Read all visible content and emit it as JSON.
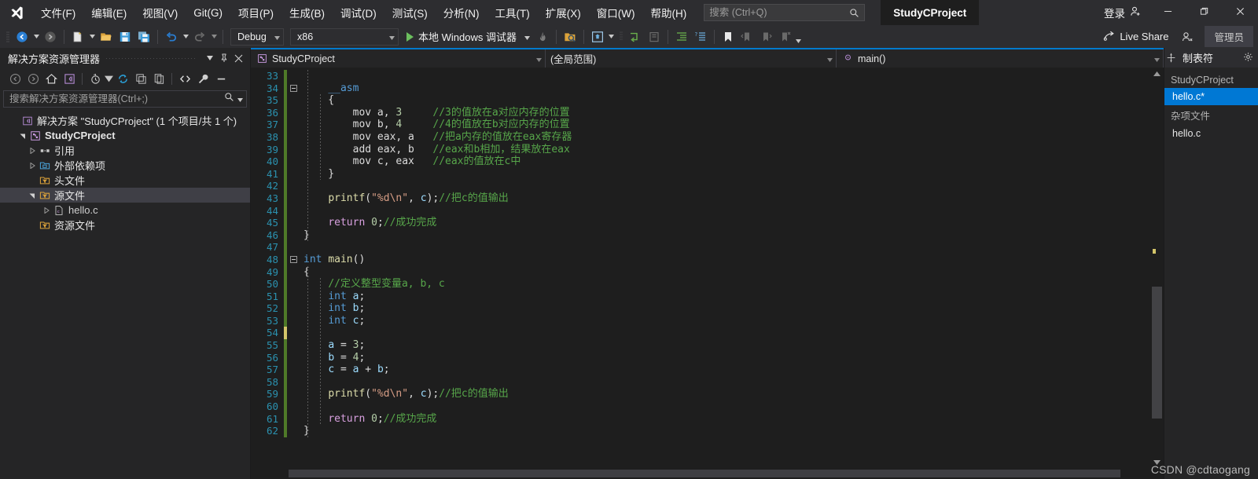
{
  "titlebar": {
    "logo_icon": "visual-studio-logo",
    "menu": [
      {
        "label": "文件(F)"
      },
      {
        "label": "编辑(E)"
      },
      {
        "label": "视图(V)"
      },
      {
        "label": "Git(G)"
      },
      {
        "label": "项目(P)"
      },
      {
        "label": "生成(B)"
      },
      {
        "label": "调试(D)"
      },
      {
        "label": "测试(S)"
      },
      {
        "label": "分析(N)"
      },
      {
        "label": "工具(T)"
      },
      {
        "label": "扩展(X)"
      },
      {
        "label": "窗口(W)"
      },
      {
        "label": "帮助(H)"
      }
    ],
    "search": {
      "placeholder": "搜索 (Ctrl+Q)",
      "value": "",
      "icon": "search-icon"
    },
    "project_chip": "StudyCProject",
    "signin_label": "登录",
    "signin_icon": "account-add-icon",
    "minimize_icon": "minimize-icon",
    "maximize_icon": "restore-icon",
    "close_icon": "close-icon"
  },
  "toolbar": {
    "nav_back_icon": "navigate-back-icon",
    "nav_forward_icon": "navigate-forward-icon",
    "new_project_icon": "new-project-icon",
    "open_icon": "open-folder-icon",
    "save_icon": "save-icon",
    "save_all_icon": "save-all-icon",
    "undo_icon": "undo-icon",
    "redo_icon": "redo-icon",
    "config_combo": {
      "value": "Debug",
      "caret": "chevron-down-icon"
    },
    "platform_combo": {
      "value": "x86",
      "caret": "chevron-down-icon"
    },
    "run_label": "本地 Windows 调试器",
    "run_icon": "play-icon",
    "hot_reload_icon": "hot-reload-icon",
    "find_in_files_icon": "find-in-files-icon",
    "solution_platform_icon": "solution-config-icon",
    "step_into_icon": "step-into-icon",
    "step_over_icon": "step-over-icon",
    "indent_icon": "increase-indent-icon",
    "comment_icon": "comment-lines-icon",
    "bookmark_icon": "bookmark-icon",
    "prev_bookmark_icon": "previous-bookmark-icon",
    "next_bookmark_icon": "next-bookmark-icon",
    "clear_bookmark_icon": "clear-bookmark-icon",
    "overflow_icon": "toolbar-overflow-icon",
    "live_share_label": "Live Share",
    "live_share_icon": "live-share-icon",
    "feedback_icon": "send-feedback-icon",
    "admin_label": "管理员"
  },
  "solution_explorer": {
    "title": "解决方案资源管理器",
    "header_caret_icon": "chevron-down-icon",
    "header_pin_icon": "pin-icon",
    "header_close_icon": "close-icon",
    "tools": [
      {
        "icon": "back-icon"
      },
      {
        "icon": "forward-icon"
      },
      {
        "icon": "home-icon"
      },
      {
        "icon": "solution-view-icon"
      },
      {
        "icon": "pending-changes-icon"
      },
      {
        "icon": "refresh-icon"
      },
      {
        "icon": "collapse-all-icon"
      },
      {
        "icon": "show-all-files-icon"
      },
      {
        "icon": "view-code-icon"
      },
      {
        "icon": "properties-icon"
      },
      {
        "icon": "preview-icon"
      }
    ],
    "search": {
      "placeholder": "搜索解决方案资源管理器(Ctrl+;)",
      "value": "",
      "icon": "search-icon",
      "caret": "chevron-down-icon"
    },
    "tree": [
      {
        "label": "解决方案 \"StudyCProject\" (1 个项目/共 1 个)",
        "indent": 0,
        "twisty": "none",
        "icon": "solution-icon",
        "bold": false,
        "selected": false
      },
      {
        "label": "StudyCProject",
        "indent": 1,
        "twisty": "expanded",
        "icon": "cpp-project-icon",
        "bold": true,
        "selected": false
      },
      {
        "label": "引用",
        "indent": 2,
        "twisty": "collapsed",
        "icon": "references-icon",
        "bold": false,
        "selected": false
      },
      {
        "label": "外部依赖项",
        "indent": 2,
        "twisty": "collapsed",
        "icon": "ext-dependencies-icon",
        "bold": false,
        "selected": false
      },
      {
        "label": "头文件",
        "indent": 2,
        "twisty": "none",
        "icon": "filter-folder-icon",
        "bold": false,
        "selected": false
      },
      {
        "label": "源文件",
        "indent": 2,
        "twisty": "expanded",
        "icon": "filter-folder-icon",
        "bold": false,
        "selected": true
      },
      {
        "label": "hello.c",
        "indent": 3,
        "twisty": "collapsed",
        "icon": "c-file-icon",
        "bold": false,
        "selected": false
      },
      {
        "label": "资源文件",
        "indent": 2,
        "twisty": "none",
        "icon": "filter-folder-icon",
        "bold": false,
        "selected": false
      }
    ]
  },
  "editor": {
    "navbar": {
      "project": {
        "value": "StudyCProject",
        "icon": "cpp-project-icon",
        "caret": "chevron-down-icon"
      },
      "scope": {
        "value": "(全局范围)",
        "caret": "chevron-down-icon"
      },
      "member": {
        "value": "main()",
        "icon": "method-icon",
        "caret": "chevron-down-icon"
      }
    },
    "first_line_number": 33,
    "lines": [
      {
        "n": 33,
        "change": "unchanged",
        "fold": false,
        "code": ""
      },
      {
        "n": 34,
        "change": "unchanged",
        "fold": true,
        "code": "    <span class=\"c-kw\">__asm</span>"
      },
      {
        "n": 35,
        "change": "unchanged",
        "fold": false,
        "code": "    {"
      },
      {
        "n": 36,
        "change": "unchanged",
        "fold": false,
        "code": "        mov a, <span class=\"c-num\">3</span>     <span class=\"c-com\">//3的值放在a对应内存的位置</span>"
      },
      {
        "n": 37,
        "change": "unchanged",
        "fold": false,
        "code": "        mov b, <span class=\"c-num\">4</span>     <span class=\"c-com\">//4的值放在b对应内存的位置</span>"
      },
      {
        "n": 38,
        "change": "unchanged",
        "fold": false,
        "code": "        mov eax, a   <span class=\"c-com\">//把a内存的值放在eax寄存器</span>"
      },
      {
        "n": 39,
        "change": "unchanged",
        "fold": false,
        "code": "        add eax, b   <span class=\"c-com\">//eax和b相加，结果放在eax</span>"
      },
      {
        "n": 40,
        "change": "unchanged",
        "fold": false,
        "code": "        mov c, eax   <span class=\"c-com\">//eax的值放在c中</span>"
      },
      {
        "n": 41,
        "change": "unchanged",
        "fold": false,
        "code": "    }"
      },
      {
        "n": 42,
        "change": "unchanged",
        "fold": false,
        "code": ""
      },
      {
        "n": 43,
        "change": "unchanged",
        "fold": false,
        "code": "    <span class=\"c-fn\">printf</span>(<span class=\"c-str\">\"%d\\n\"</span>, <span class=\"c-var\">c</span>);<span class=\"c-com\">//把c的值输出</span>"
      },
      {
        "n": 44,
        "change": "unchanged",
        "fold": false,
        "code": ""
      },
      {
        "n": 45,
        "change": "unchanged",
        "fold": false,
        "code": "    <span class=\"c-kwp\">return</span> <span class=\"c-num\">0</span>;<span class=\"c-com\">//成功完成</span>"
      },
      {
        "n": 46,
        "change": "unchanged",
        "fold": false,
        "code": "}"
      },
      {
        "n": 47,
        "change": "unchanged",
        "fold": false,
        "code": ""
      },
      {
        "n": 48,
        "change": "unchanged",
        "fold": true,
        "code": "<span class=\"c-kw\">int</span> <span class=\"c-fn\">main</span>()"
      },
      {
        "n": 49,
        "change": "unchanged",
        "fold": false,
        "code": "{"
      },
      {
        "n": 50,
        "change": "unchanged",
        "fold": false,
        "code": "    <span class=\"c-com\">//定义整型变量a, b, c</span>"
      },
      {
        "n": 51,
        "change": "unchanged",
        "fold": false,
        "code": "    <span class=\"c-kw\">int</span> <span class=\"c-var\">a</span>;"
      },
      {
        "n": 52,
        "change": "unchanged",
        "fold": false,
        "code": "    <span class=\"c-kw\">int</span> <span class=\"c-var\">b</span>;"
      },
      {
        "n": 53,
        "change": "unchanged",
        "fold": false,
        "code": "    <span class=\"c-kw\">int</span> <span class=\"c-var\">c</span>;"
      },
      {
        "n": 54,
        "change": "modified",
        "fold": false,
        "code": ""
      },
      {
        "n": 55,
        "change": "unchanged",
        "fold": false,
        "code": "    <span class=\"c-var\">a</span> = <span class=\"c-num\">3</span>;"
      },
      {
        "n": 56,
        "change": "unchanged",
        "fold": false,
        "code": "    <span class=\"c-var\">b</span> = <span class=\"c-num\">4</span>;"
      },
      {
        "n": 57,
        "change": "unchanged",
        "fold": false,
        "code": "    <span class=\"c-var\">c</span> = <span class=\"c-var\">a</span> + <span class=\"c-var\">b</span>;"
      },
      {
        "n": 58,
        "change": "unchanged",
        "fold": false,
        "code": ""
      },
      {
        "n": 59,
        "change": "unchanged",
        "fold": false,
        "code": "    <span class=\"c-fn\">printf</span>(<span class=\"c-str\">\"%d\\n\"</span>, <span class=\"c-var\">c</span>);<span class=\"c-com\">//把c的值输出</span>"
      },
      {
        "n": 60,
        "change": "unchanged",
        "fold": false,
        "code": ""
      },
      {
        "n": 61,
        "change": "unchanged",
        "fold": false,
        "code": "    <span class=\"c-kwp\">return</span> <span class=\"c-num\">0</span>;<span class=\"c-com\">//成功完成</span>"
      },
      {
        "n": 62,
        "change": "unchanged",
        "fold": false,
        "code": "}"
      }
    ]
  },
  "right_panel": {
    "title": "制表符",
    "split_icon": "split-window-icon",
    "gear_icon": "gear-icon",
    "groups": [
      {
        "label": "StudyCProject",
        "items": [
          {
            "label": "hello.c*",
            "selected": true
          }
        ]
      },
      {
        "label": "杂项文件",
        "items": [
          {
            "label": "hello.c",
            "selected": false
          }
        ]
      }
    ]
  },
  "watermark": "CSDN @cdtaogang",
  "colors": {
    "accent": "#007acc",
    "selection_blue": "#0078d4",
    "editor_bg": "#1e1e1e",
    "chrome_bg": "#2d2d30",
    "panel_bg": "#252526",
    "change_green": "#4f7a28",
    "change_yellow": "#d4c56a",
    "line_number": "#2b91af",
    "comment_green": "#57a64a",
    "keyword_blue": "#569cd6"
  }
}
